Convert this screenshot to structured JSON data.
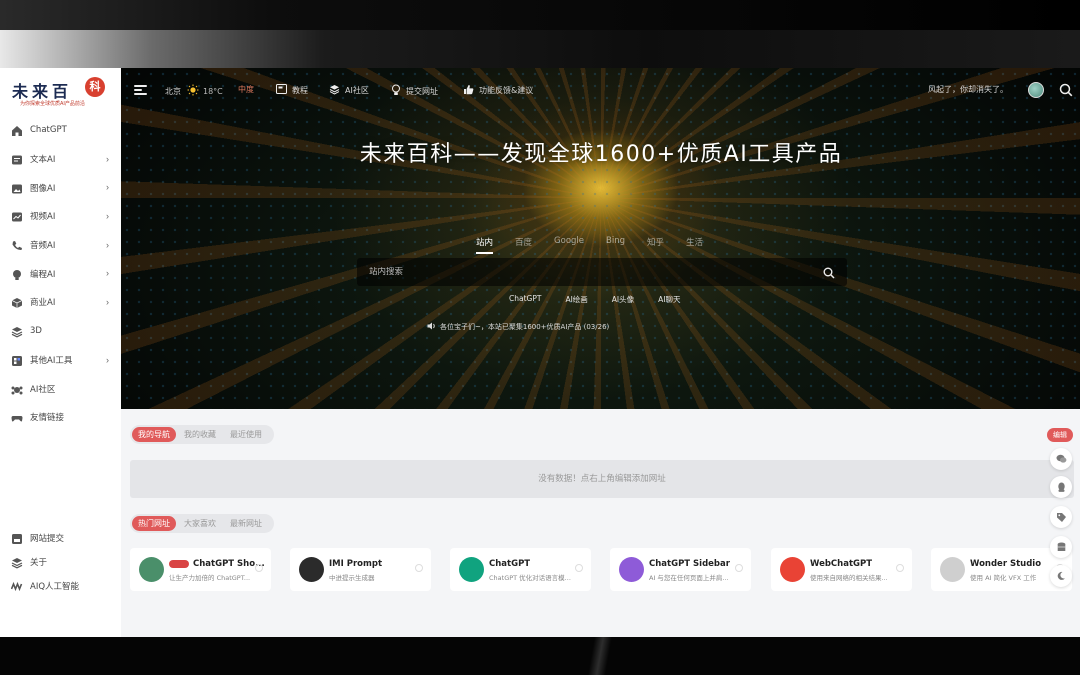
{
  "logo": {
    "name": "未来百",
    "badge": "科",
    "tagline": "为你探索全球优质AI产品前沿"
  },
  "sidebar": {
    "items": [
      {
        "label": "ChatGPT",
        "icon": "home-icon",
        "arrow": false
      },
      {
        "label": "文本AI",
        "icon": "text-icon",
        "arrow": true
      },
      {
        "label": "图像AI",
        "icon": "image-icon",
        "arrow": true
      },
      {
        "label": "视频AI",
        "icon": "video-icon",
        "arrow": true
      },
      {
        "label": "音频AI",
        "icon": "phone-icon",
        "arrow": true
      },
      {
        "label": "编程AI",
        "icon": "bulb-icon",
        "arrow": true
      },
      {
        "label": "商业AI",
        "icon": "box-icon",
        "arrow": true
      },
      {
        "label": "3D",
        "icon": "layers-icon",
        "arrow": false
      },
      {
        "label": "其他AI工具",
        "icon": "grid-icon",
        "arrow": true
      },
      {
        "label": "AI社区",
        "icon": "community-icon",
        "arrow": false
      },
      {
        "label": "友情链接",
        "icon": "gamepad-icon",
        "arrow": false
      }
    ],
    "bottom": [
      {
        "label": "网站提交",
        "icon": "submit-icon"
      },
      {
        "label": "关于",
        "icon": "layers-icon"
      },
      {
        "label": "AIQ人工智能",
        "icon": "wave-icon"
      }
    ]
  },
  "topbar": {
    "city": "北京",
    "temp": "18°C",
    "level": "中度",
    "links": [
      "教程",
      "AI社区",
      "提交网址",
      "功能反馈&建议"
    ],
    "slogan": "风起了，你却消失了。"
  },
  "hero": {
    "title": "未来百科——发现全球1600+优质AI工具产品",
    "tabs": [
      "站内",
      "百度",
      "Google",
      "Bing",
      "知乎",
      "生活"
    ],
    "active_tab": 0,
    "search_placeholder": "站内搜索",
    "quick_links": [
      "ChatGPT",
      "AI绘画",
      "AI头像",
      "AI聊天"
    ],
    "notice": "各位宝子们~，本站已聚集1600+优质AI产品 (03/26)"
  },
  "my_nav": {
    "tabs": [
      "我的导航",
      "我的收藏",
      "最近使用"
    ],
    "active": 0,
    "empty_text": "没有数据！点右上角编辑添加网址"
  },
  "hot": {
    "tabs": [
      "热门网址",
      "大家喜欢",
      "最新网址"
    ],
    "active": 0,
    "cards": [
      {
        "title": "ChatGPT Sho...",
        "desc": "让生产力加倍的 ChatGPT...",
        "hot": true,
        "icon_color": "#4a8f6a"
      },
      {
        "title": "IMI Prompt",
        "desc": "中进提示生成器",
        "hot": false,
        "icon_color": "#2b2b2b"
      },
      {
        "title": "ChatGPT",
        "desc": "ChatGPT 优化对话语言模...",
        "hot": false,
        "icon_color": "#10a37f"
      },
      {
        "title": "ChatGPT Sidebar",
        "desc": "AI 与您在任何页面上并肩...",
        "hot": false,
        "icon_color": "#8e5bd8"
      },
      {
        "title": "WebChatGPT",
        "desc": "使用来自网络的相关结果...",
        "hot": false,
        "icon_color": "#e94335"
      },
      {
        "title": "Wonder Studio",
        "desc": "使用 AI 简化 VFX 工作",
        "hot": false,
        "icon_color": "#cfcfcf"
      }
    ]
  },
  "float": {
    "tag": "编辑"
  },
  "colors": {
    "accent": "#e05a5a",
    "sidebar_text": "#444444",
    "brand": "#1c2b52"
  }
}
